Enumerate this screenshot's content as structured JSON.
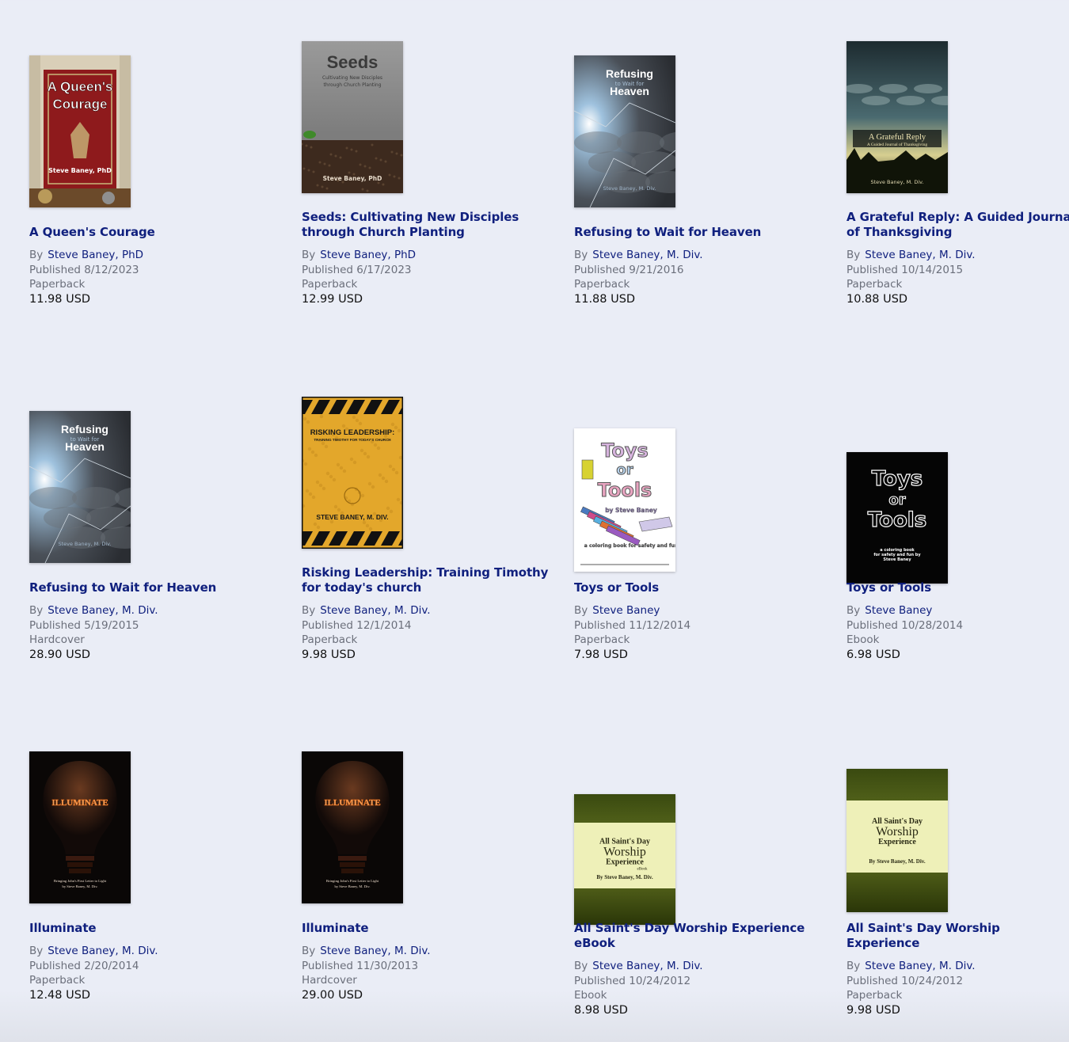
{
  "books": [
    {
      "title": "A Queen's Courage",
      "by_label": "By",
      "author": "Steve Baney, PhD",
      "published": "Published 8/12/2023",
      "format": "Paperback",
      "price": "11.98 USD",
      "cover": {
        "icon": "queen-courage-cover",
        "lines": [
          "A Queen's",
          "Courage"
        ],
        "subtitle": "",
        "author_line": "Steve Baney, PhD",
        "colors": {
          "bg": "#8e1a1c",
          "accent": "#c9b77a",
          "text": "#ffffff"
        }
      }
    },
    {
      "title": "Seeds: Cultivating New Disciples through Church Planting",
      "by_label": "By",
      "author": "Steve Baney, PhD",
      "published": "Published 6/17/2023",
      "format": "Paperback",
      "price": "12.99 USD",
      "cover": {
        "icon": "seeds-cover",
        "lines": [
          "Seeds"
        ],
        "subtitle": "Cultivating New Disciples through Church Planting",
        "author_line": "Steve Baney, PhD",
        "colors": {
          "bg": "#8c8c8c",
          "accent": "#3d2a1e",
          "text": "#3a3a3a"
        }
      }
    },
    {
      "title": "Refusing to Wait for Heaven",
      "by_label": "By",
      "author": "Steve Baney, M. Div.",
      "published": "Published 9/21/2016",
      "format": "Paperback",
      "price": "11.88 USD",
      "cover": {
        "icon": "refusing-heaven-cover",
        "lines": [
          "Refusing",
          "Heaven"
        ],
        "subtitle": "to Wait for",
        "author_line": "Steve Baney, M. Div.",
        "colors": {
          "bg": "#3c4048",
          "accent": "#9fb4c8",
          "text": "#ffffff"
        }
      }
    },
    {
      "title": "A Grateful Reply: A Guided Journal of Thanksgiving",
      "by_label": "By",
      "author": "Steve Baney, M. Div.",
      "published": "Published 10/14/2015",
      "format": "Paperback",
      "price": "10.88 USD",
      "cover": {
        "icon": "grateful-reply-cover",
        "lines": [
          "A Grateful Reply"
        ],
        "subtitle": "A Guided Journal of Thanksgiving",
        "author_line": "Steve Baney, M. Div.",
        "colors": {
          "bg": "#2a3d3c",
          "accent": "#c7b35a",
          "text": "#f0e6b4"
        }
      }
    },
    {
      "title": "Refusing to Wait for Heaven",
      "by_label": "By",
      "author": "Steve Baney, M. Div.",
      "published": "Published 5/19/2015",
      "format": "Hardcover",
      "price": "28.90 USD",
      "cover": {
        "icon": "refusing-heaven-cover",
        "lines": [
          "Refusing",
          "Heaven"
        ],
        "subtitle": "to Wait for",
        "author_line": "Steve Baney, M. Div.",
        "colors": {
          "bg": "#3c4048",
          "accent": "#9fb4c8",
          "text": "#ffffff"
        }
      }
    },
    {
      "title": "Risking Leadership: Training Timothy for today's church",
      "by_label": "By",
      "author": "Steve Baney, M. Div.",
      "published": "Published 12/1/2014",
      "format": "Paperback",
      "price": "9.98 USD",
      "cover": {
        "icon": "risking-leadership-cover",
        "lines": [
          "RISKING LEADERSHIP:"
        ],
        "subtitle": "TRAINING TIMOTHY FOR TODAY'S CHURCH",
        "author_line": "STEVE BANEY, M. DIV.",
        "colors": {
          "bg": "#e3a72b",
          "accent": "#111111",
          "text": "#1a1a1a"
        }
      }
    },
    {
      "title": "Toys or Tools",
      "by_label": "By",
      "author": "Steve Baney",
      "published": "Published 11/12/2014",
      "format": "Paperback",
      "price": "7.98 USD",
      "cover": {
        "icon": "toys-tools-coloring-cover",
        "lines": [
          "Toys",
          "or",
          "Tools"
        ],
        "subtitle": "a coloring book for safety and fun",
        "author_line": "by Steve Baney",
        "colors": {
          "bg": "#ffffff",
          "accent": "#b07ab8",
          "text": "#555555"
        }
      }
    },
    {
      "title": "Toys or Tools",
      "by_label": "By",
      "author": "Steve Baney",
      "published": "Published 10/28/2014",
      "format": "Ebook",
      "price": "6.98 USD",
      "cover": {
        "icon": "toys-tools-black-cover",
        "lines": [
          "Toys",
          "or",
          "Tools"
        ],
        "subtitle": "a coloring book for safety and fun by Steve Baney",
        "author_line": "",
        "colors": {
          "bg": "#050505",
          "accent": "#ffffff",
          "text": "#ffffff"
        }
      }
    },
    {
      "title": "Illuminate",
      "by_label": "By",
      "author": "Steve Baney, M. Div.",
      "published": "Published 2/20/2014",
      "format": "Paperback",
      "price": "12.48 USD",
      "cover": {
        "icon": "illuminate-cover",
        "lines": [
          "ILLUMINATE"
        ],
        "subtitle": "Bringing John's First Letter to Light",
        "author_line": "by Steve Baney, M. Div.",
        "colors": {
          "bg": "#0a0706",
          "accent": "#5a2612",
          "text": "#e8a060"
        }
      }
    },
    {
      "title": "Illuminate",
      "by_label": "By",
      "author": "Steve Baney, M. Div.",
      "published": "Published 11/30/2013",
      "format": "Hardcover",
      "price": "29.00 USD",
      "cover": {
        "icon": "illuminate-cover",
        "lines": [
          "ILLUMINATE"
        ],
        "subtitle": "Bringing John's First Letter to Light",
        "author_line": "by Steve Baney, M. Div.",
        "colors": {
          "bg": "#0a0706",
          "accent": "#5a2612",
          "text": "#e8a060"
        }
      }
    },
    {
      "title": "All Saint's Day Worship Experience eBook",
      "by_label": "By",
      "author": "Steve Baney, M. Div.",
      "published": "Published 10/24/2012",
      "format": "Ebook",
      "price": "8.98 USD",
      "cover": {
        "icon": "all-saints-cover",
        "lines": [
          "All Saint's Day",
          "Worship",
          "Experience"
        ],
        "subtitle": "eBook",
        "author_line": "By Steve Baney, M. Div.",
        "colors": {
          "bg": "#3f4f12",
          "accent": "#eef0b8",
          "text": "#2a2a14"
        }
      }
    },
    {
      "title": "All Saint's Day Worship Experience",
      "by_label": "By",
      "author": "Steve Baney, M. Div.",
      "published": "Published 10/24/2012",
      "format": "Paperback",
      "price": "9.98 USD",
      "cover": {
        "icon": "all-saints-cover",
        "lines": [
          "All Saint's Day",
          "Worship",
          "Experience"
        ],
        "subtitle": "",
        "author_line": "By Steve Baney, M. Div.",
        "colors": {
          "bg": "#3f4f12",
          "accent": "#eef0b8",
          "text": "#2a2a14"
        }
      }
    }
  ]
}
